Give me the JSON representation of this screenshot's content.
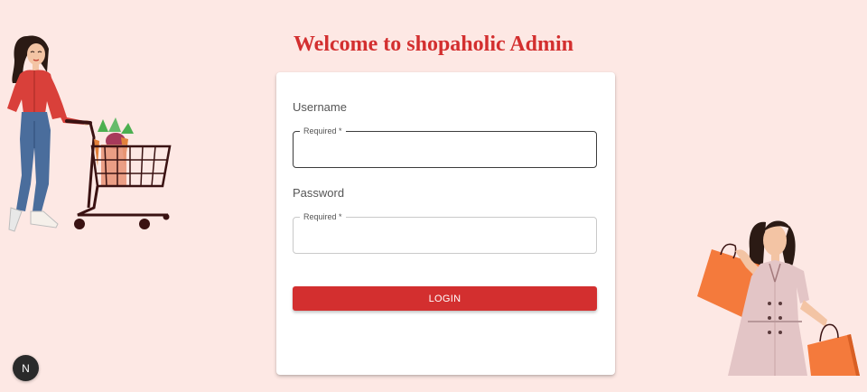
{
  "header": {
    "title": "Welcome to shopaholic Admin"
  },
  "form": {
    "username_label": "Username",
    "username_floating": "Required *",
    "username_value": "",
    "password_label": "Password",
    "password_floating": "Required *",
    "password_value": "",
    "login_label": "LOGIN"
  },
  "badge": {
    "letter": "N"
  },
  "colors": {
    "background": "#fde8e4",
    "accent": "#d32f2f",
    "card": "#ffffff"
  },
  "icons": {
    "left_illustration": "woman-with-shopping-cart-illustration",
    "right_illustration": "woman-with-shopping-bags-illustration",
    "badge": "nextjs-logo-icon"
  }
}
